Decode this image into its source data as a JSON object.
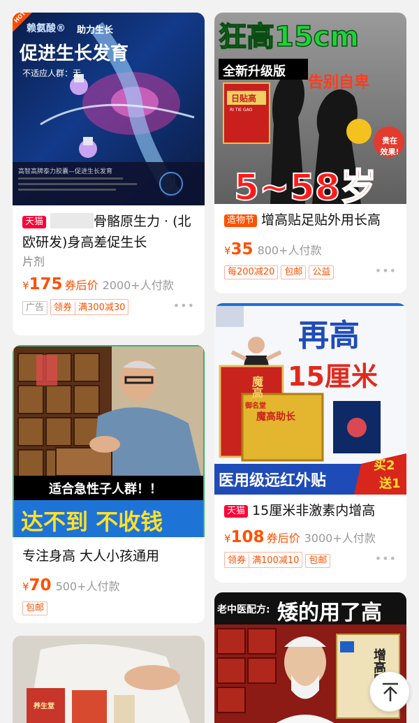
{
  "colors": {
    "accent": "#ff5000",
    "tmall": "#ff0036",
    "bg": "#f2f2f2"
  },
  "cards": [
    {
      "image": {
        "hot": "HOT",
        "brand": "赖氨酸®",
        "tagline": "助力生长",
        "headline": "促进生长发育",
        "subline": "不适应人群：无",
        "footer": "高智高牌泰力胶囊—促进生长发育"
      },
      "badge": "天猫",
      "title": "骨骼原生力 · (北欧研发)身高差促生长",
      "spec": "片剂",
      "price_symbol": "¥",
      "price": "175",
      "after_label": "券后价",
      "sold": "2000+人付款",
      "ad_tag": "广告",
      "coupon": "领券",
      "discount": "满300减30",
      "more": "•••"
    },
    {
      "image": {
        "headline": "狂高15cm",
        "ribbon": "全新升级版",
        "slogan": "告别自卑",
        "box_title": "日贴高",
        "box_sub": "RI TIE GAO",
        "seal": "贵在效果!",
        "ages": "5~58岁"
      },
      "badge": "造物节",
      "title": "增高贴足贴外用长高",
      "price_symbol": "¥",
      "price": "35",
      "sold": "800+人付款",
      "tags": [
        "每200减20",
        "包邮",
        "公益"
      ],
      "more": "•••"
    },
    {
      "image": {
        "caption": "适合急性子人群！！",
        "promise": "达不到 不收钱"
      },
      "title": "专注身高 大人小孩通用",
      "price_symbol": "¥",
      "price": "70",
      "sold": "500+人付款",
      "tags": [
        "包邮"
      ],
      "more": "•••"
    },
    {
      "image": {
        "headline_1": "再高",
        "headline_2": "15厘米",
        "box_title": "魔高助长",
        "box_side": "魔高",
        "box_top": "御名堂",
        "banner": "医用级远红外贴",
        "promo_1": "买2",
        "promo_2": "送1"
      },
      "badge": "天猫",
      "title": "15厘米非激素内增高",
      "price_symbol": "¥",
      "price": "108",
      "after_label": "券后价",
      "sold": "3000+人付款",
      "coupon": "领券",
      "discount": "满100减10",
      "tags": [
        "包邮"
      ],
      "more": "•••"
    },
    {
      "image": {
        "box_label": "养生堂"
      }
    },
    {
      "image": {
        "prefix": "老中医配方:",
        "headline": "矮的用了高",
        "box_title": "增高贴"
      }
    }
  ],
  "back_to_top": {
    "icon": "arrow-up-to-top-icon"
  }
}
